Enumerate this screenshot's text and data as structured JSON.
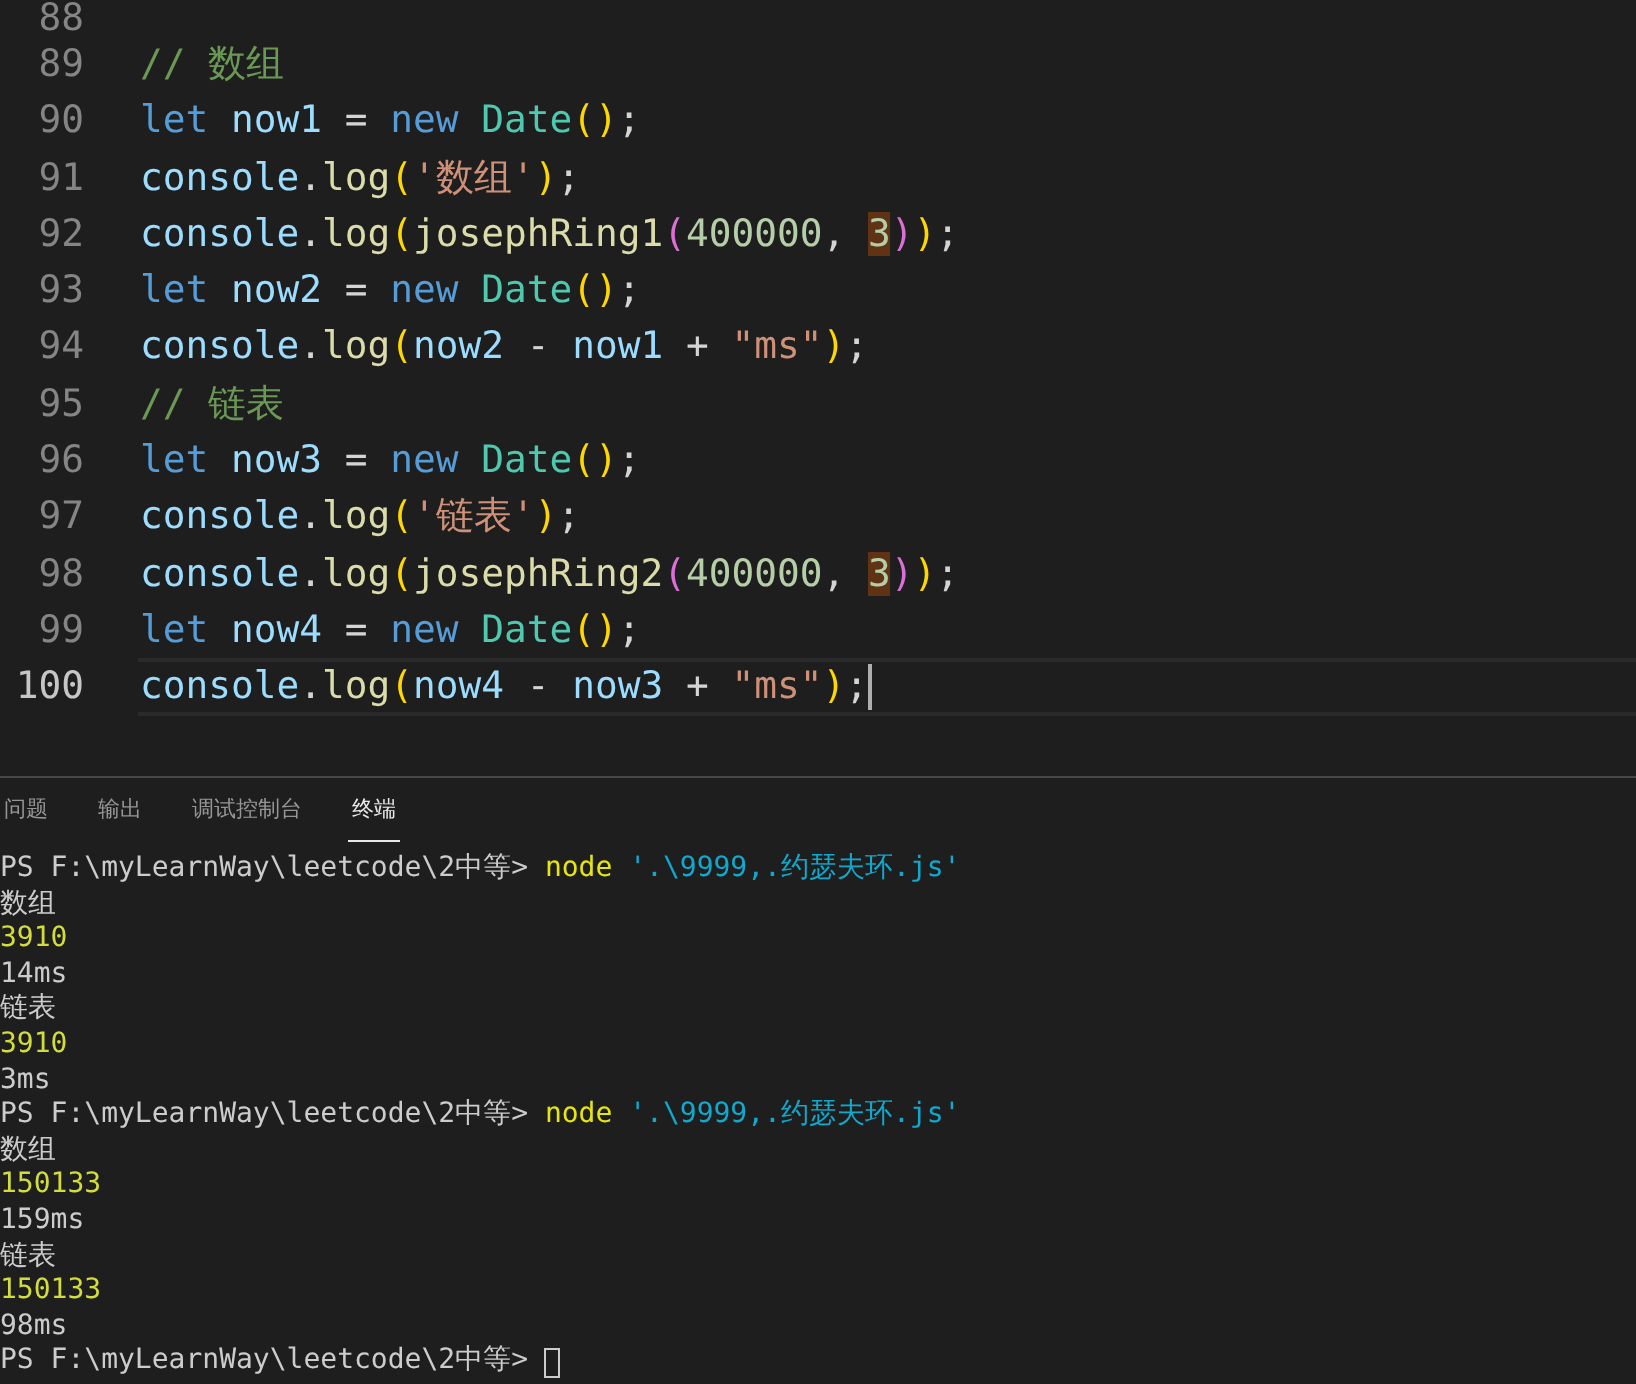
{
  "editor": {
    "lines": [
      {
        "number": "88",
        "current": false
      },
      {
        "number": "89",
        "current": false,
        "tokens": [
          {
            "kind": "comment",
            "text": "// 数组"
          }
        ]
      },
      {
        "number": "90",
        "current": false,
        "tokens": [
          {
            "kind": "keyword",
            "text": "let "
          },
          {
            "kind": "variable",
            "text": "now1 "
          },
          {
            "kind": "punctuation",
            "text": "= "
          },
          {
            "kind": "keyword",
            "text": "new "
          },
          {
            "kind": "class",
            "text": "Date"
          },
          {
            "kind": "bracket1",
            "text": "("
          },
          {
            "kind": "bracket1",
            "text": ")"
          },
          {
            "kind": "punctuation",
            "text": ";"
          }
        ]
      },
      {
        "number": "91",
        "current": false,
        "tokens": [
          {
            "kind": "variable",
            "text": "console"
          },
          {
            "kind": "punctuation",
            "text": "."
          },
          {
            "kind": "function",
            "text": "log"
          },
          {
            "kind": "bracket1",
            "text": "("
          },
          {
            "kind": "string",
            "text": "'数组'"
          },
          {
            "kind": "bracket1",
            "text": ")"
          },
          {
            "kind": "punctuation",
            "text": ";"
          }
        ]
      },
      {
        "number": "92",
        "current": false,
        "tokens": [
          {
            "kind": "variable",
            "text": "console"
          },
          {
            "kind": "punctuation",
            "text": "."
          },
          {
            "kind": "function",
            "text": "log"
          },
          {
            "kind": "bracket1",
            "text": "("
          },
          {
            "kind": "function",
            "text": "josephRing1"
          },
          {
            "kind": "bracket2",
            "text": "("
          },
          {
            "kind": "number",
            "text": "400000"
          },
          {
            "kind": "punctuation",
            "text": ", "
          },
          {
            "kind": "highlighted_number",
            "text": "3"
          },
          {
            "kind": "bracket2",
            "text": ")"
          },
          {
            "kind": "bracket1",
            "text": ")"
          },
          {
            "kind": "punctuation",
            "text": ";"
          }
        ]
      },
      {
        "number": "93",
        "current": false,
        "tokens": [
          {
            "kind": "keyword",
            "text": "let "
          },
          {
            "kind": "variable",
            "text": "now2 "
          },
          {
            "kind": "punctuation",
            "text": "= "
          },
          {
            "kind": "keyword",
            "text": "new "
          },
          {
            "kind": "class",
            "text": "Date"
          },
          {
            "kind": "bracket1",
            "text": "("
          },
          {
            "kind": "bracket1",
            "text": ")"
          },
          {
            "kind": "punctuation",
            "text": ";"
          }
        ]
      },
      {
        "number": "94",
        "current": false,
        "tokens": [
          {
            "kind": "variable",
            "text": "console"
          },
          {
            "kind": "punctuation",
            "text": "."
          },
          {
            "kind": "function",
            "text": "log"
          },
          {
            "kind": "bracket1",
            "text": "("
          },
          {
            "kind": "variable",
            "text": "now2 "
          },
          {
            "kind": "punctuation",
            "text": "- "
          },
          {
            "kind": "variable",
            "text": "now1 "
          },
          {
            "kind": "punctuation",
            "text": "+ "
          },
          {
            "kind": "string",
            "text": "\"ms\""
          },
          {
            "kind": "bracket1",
            "text": ")"
          },
          {
            "kind": "punctuation",
            "text": ";"
          }
        ]
      },
      {
        "number": "95",
        "current": false,
        "tokens": [
          {
            "kind": "comment",
            "text": "// 链表"
          }
        ]
      },
      {
        "number": "96",
        "current": false,
        "tokens": [
          {
            "kind": "keyword",
            "text": "let "
          },
          {
            "kind": "variable",
            "text": "now3 "
          },
          {
            "kind": "punctuation",
            "text": "= "
          },
          {
            "kind": "keyword",
            "text": "new "
          },
          {
            "kind": "class",
            "text": "Date"
          },
          {
            "kind": "bracket1",
            "text": "("
          },
          {
            "kind": "bracket1",
            "text": ")"
          },
          {
            "kind": "punctuation",
            "text": ";"
          }
        ]
      },
      {
        "number": "97",
        "current": false,
        "tokens": [
          {
            "kind": "variable",
            "text": "console"
          },
          {
            "kind": "punctuation",
            "text": "."
          },
          {
            "kind": "function",
            "text": "log"
          },
          {
            "kind": "bracket1",
            "text": "("
          },
          {
            "kind": "string",
            "text": "'链表'"
          },
          {
            "kind": "bracket1",
            "text": ")"
          },
          {
            "kind": "punctuation",
            "text": ";"
          }
        ]
      },
      {
        "number": "98",
        "current": false,
        "tokens": [
          {
            "kind": "variable",
            "text": "console"
          },
          {
            "kind": "punctuation",
            "text": "."
          },
          {
            "kind": "function",
            "text": "log"
          },
          {
            "kind": "bracket1",
            "text": "("
          },
          {
            "kind": "function",
            "text": "josephRing2"
          },
          {
            "kind": "bracket2",
            "text": "("
          },
          {
            "kind": "number",
            "text": "400000"
          },
          {
            "kind": "punctuation",
            "text": ", "
          },
          {
            "kind": "highlighted_number",
            "text": "3"
          },
          {
            "kind": "bracket2",
            "text": ")"
          },
          {
            "kind": "bracket1",
            "text": ")"
          },
          {
            "kind": "punctuation",
            "text": ";"
          }
        ]
      },
      {
        "number": "99",
        "current": false,
        "tokens": [
          {
            "kind": "keyword",
            "text": "let "
          },
          {
            "kind": "variable",
            "text": "now4 "
          },
          {
            "kind": "punctuation",
            "text": "= "
          },
          {
            "kind": "keyword",
            "text": "new "
          },
          {
            "kind": "class",
            "text": "Date"
          },
          {
            "kind": "bracket1",
            "text": "("
          },
          {
            "kind": "bracket1",
            "text": ")"
          },
          {
            "kind": "punctuation",
            "text": ";"
          }
        ]
      },
      {
        "number": "100",
        "current": true,
        "tokens": [
          {
            "kind": "variable",
            "text": "console"
          },
          {
            "kind": "punctuation",
            "text": "."
          },
          {
            "kind": "function",
            "text": "log"
          },
          {
            "kind": "bracket1",
            "text": "("
          },
          {
            "kind": "variable",
            "text": "now4 "
          },
          {
            "kind": "punctuation",
            "text": "- "
          },
          {
            "kind": "variable",
            "text": "now3 "
          },
          {
            "kind": "punctuation",
            "text": "+ "
          },
          {
            "kind": "string",
            "text": "\"ms\""
          },
          {
            "kind": "bracket1",
            "text": ")"
          },
          {
            "kind": "punctuation",
            "text": ";"
          }
        ]
      }
    ]
  },
  "panel": {
    "tabs": [
      {
        "label": "问题",
        "selected": false
      },
      {
        "label": "输出",
        "selected": false
      },
      {
        "label": "调试控制台",
        "selected": false
      },
      {
        "label": "终端",
        "selected": true
      }
    ],
    "terminal": {
      "cursor": true,
      "lines": [
        {
          "segments": [
            {
              "kind": "prompt",
              "text": "PS F:\\myLearnWay\\leetcode\\2中等>"
            },
            {
              "kind": "command",
              "text": "node"
            },
            {
              "kind": "argument",
              "text": "'.\\9999,.约瑟夫环.js'"
            }
          ]
        },
        {
          "segments": [
            {
              "kind": "output",
              "text": "数组"
            }
          ]
        },
        {
          "segments": [
            {
              "kind": "value",
              "text": "3910"
            }
          ]
        },
        {
          "segments": [
            {
              "kind": "output",
              "text": "14ms"
            }
          ]
        },
        {
          "segments": [
            {
              "kind": "output",
              "text": "链表"
            }
          ]
        },
        {
          "segments": [
            {
              "kind": "value",
              "text": "3910"
            }
          ]
        },
        {
          "segments": [
            {
              "kind": "output",
              "text": "3ms"
            }
          ]
        },
        {
          "segments": [
            {
              "kind": "prompt",
              "text": "PS F:\\myLearnWay\\leetcode\\2中等>"
            },
            {
              "kind": "command",
              "text": "node"
            },
            {
              "kind": "argument",
              "text": "'.\\9999,.约瑟夫环.js'"
            }
          ]
        },
        {
          "segments": [
            {
              "kind": "output",
              "text": "数组"
            }
          ]
        },
        {
          "segments": [
            {
              "kind": "value",
              "text": "150133"
            }
          ]
        },
        {
          "segments": [
            {
              "kind": "output",
              "text": "159ms"
            }
          ]
        },
        {
          "segments": [
            {
              "kind": "output",
              "text": "链表"
            }
          ]
        },
        {
          "segments": [
            {
              "kind": "value",
              "text": "150133"
            }
          ]
        },
        {
          "segments": [
            {
              "kind": "output",
              "text": "98ms"
            }
          ]
        },
        {
          "segments": [
            {
              "kind": "prompt",
              "text": "PS F:\\myLearnWay\\leetcode\\2中等>"
            }
          ]
        }
      ]
    }
  }
}
